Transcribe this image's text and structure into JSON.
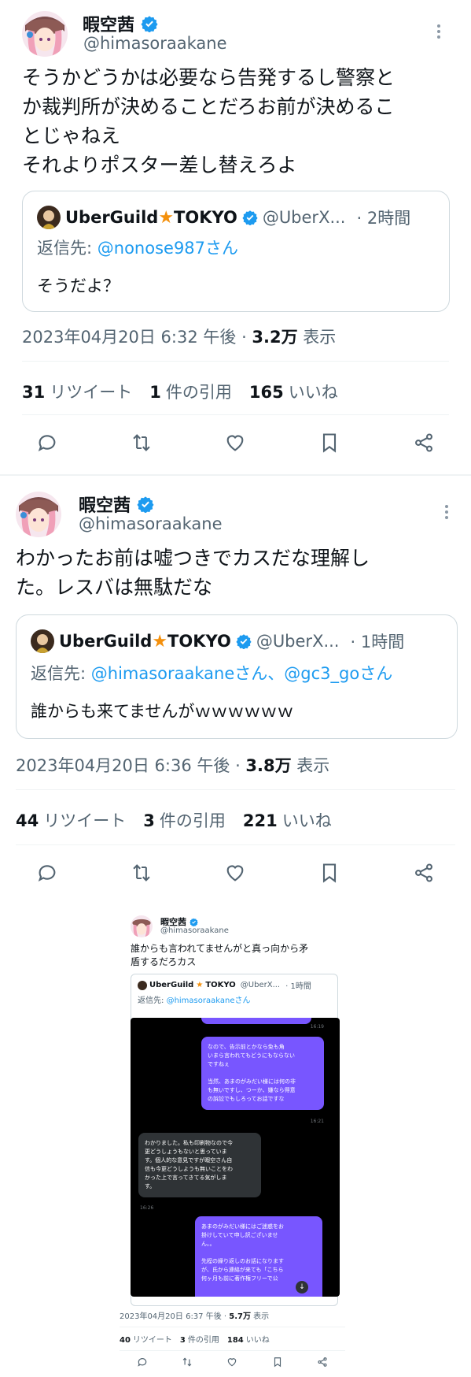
{
  "colors": {
    "accent": "#1d9bf0",
    "text": "#0f1419",
    "muted": "#536471",
    "verified": "#1d9bf0",
    "star": "#f4900c",
    "dm_bubble": "#7856ff"
  },
  "tweet1": {
    "display_name": "暇空茜",
    "handle": "@himasoraakane",
    "text": "そうかどうかは必要なら告発するし警察と\nか裁判所が決めることだろお前が決めるこ\nとじゃねえ\nそれよりポスター差し替えろよ",
    "quote": {
      "name": "UberGuild",
      "name_suffix": "TOKYO",
      "handle": "@UberX...",
      "time": "· 2時間",
      "reply_prefix": "返信先: ",
      "reply_to": "@nonose987さん",
      "text": "そうだよ？"
    },
    "timestamp": "2023年04月20日 6:32 午後 · ",
    "views": "3.2万",
    "views_label": " 表示",
    "retweets": "31",
    "retweets_label": "リツイート",
    "quotes": "1",
    "quotes_label": "件の引用",
    "likes": "165",
    "likes_label": "いいね"
  },
  "tweet2": {
    "display_name": "暇空茜",
    "handle": "@himasoraakane",
    "text": "わかったお前は嘘つきでカスだな理解し\nた。レスバは無駄だな",
    "quote": {
      "name": "UberGuild",
      "name_suffix": "TOKYO",
      "handle": "@UberX...",
      "time": "· 1時間",
      "reply_prefix": "返信先: ",
      "reply_to": "@himasoraakaneさん、@gc3_goさん",
      "text": "誰からも来てませんがｗｗｗｗｗｗ"
    },
    "timestamp": "2023年04月20日 6:36 午後 · ",
    "views": "3.8万",
    "views_label": " 表示",
    "retweets": "44",
    "retweets_label": "リツイート",
    "quotes": "3",
    "quotes_label": "件の引用",
    "likes": "221",
    "likes_label": "いいね"
  },
  "embedded": {
    "display_name": "暇空茜",
    "handle": "@himasoraakane",
    "text": "誰からも言われてませんがと真っ向から矛\n盾するだろカス",
    "quote": {
      "name": "UberGuild",
      "name_suffix": "TOKYO",
      "handle": "@UberX...",
      "time": "· 1時間",
      "reply_prefix": "返信先: ",
      "reply_to": "@himasoraakaneさん"
    },
    "dm": {
      "msg1": "なので、告示前とかなら免も角\nいまら言われてもどうにもならない\nですねぇ\n\n当然、あまのがみだい様には何の非\nも無いですし、つーか、嫌なら得意\nの訴訟でもしろってお話ですな",
      "time1": "16:19",
      "time2": "16:21",
      "msg2": "わかりました。私も印刷物なので今\n更どうしょうもないと思っていま\nす。個人的な意見ですが暇空さん自\n信も今更どうしようも無いことをわ\nかった上で言ってきてる気がしま\nす。",
      "time3": "16:26",
      "msg3": "あまのがみだい様にはご迷惑をお\n掛けしていて申し訳ございませ\nん。。\n\n先程の繰り返しのお話になります\nが、氏から連絡が来ても「こちら\n何ヶ月も前に著作権フリーで公"
    },
    "timestamp": "2023年04月20日 6:37 午後 · ",
    "views": "5.7万",
    "views_label": " 表示",
    "retweets": "40",
    "retweets_label": "リツイート",
    "quotes": "3",
    "quotes_label": "件の引用",
    "likes": "184",
    "likes_label": "いいね"
  }
}
